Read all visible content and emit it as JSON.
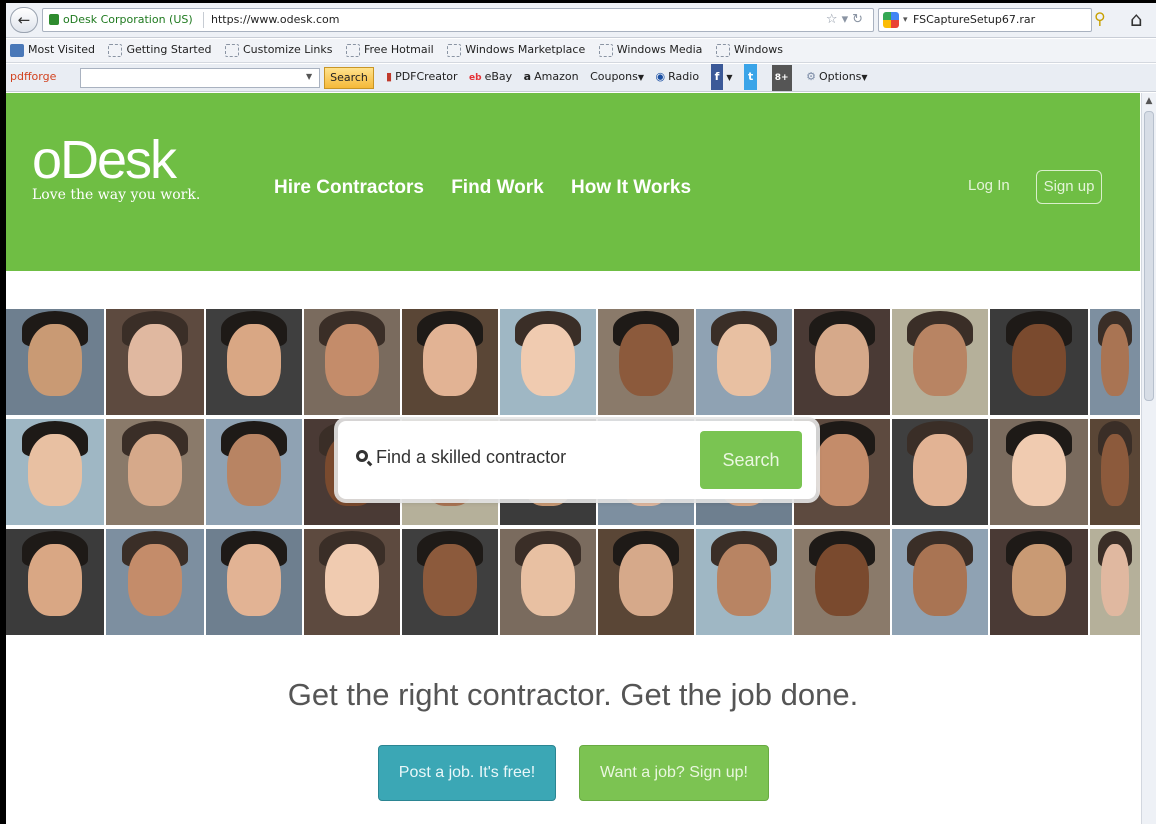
{
  "browser": {
    "site_identity": "oDesk Corporation (US)",
    "url": "https://www.odesk.com",
    "search_value": "FSCaptureSetup67.rar"
  },
  "bookmarks": [
    "Most Visited",
    "Getting Started",
    "Customize Links",
    "Free Hotmail",
    "Windows Marketplace",
    "Windows Media",
    "Windows"
  ],
  "toolbar": {
    "brand": "pdfforge",
    "search_label": "Search",
    "items": [
      "PDFCreator",
      "eBay",
      "Amazon",
      "Coupons",
      "Radio",
      "Options"
    ]
  },
  "header": {
    "logo": "oDesk",
    "tagline": "Love the way you work.",
    "nav": [
      "Hire Contractors",
      "Find Work",
      "How It Works"
    ],
    "login_label": "Log In",
    "signup_label": "Sign up"
  },
  "search": {
    "placeholder": "Find a skilled contractor",
    "button_label": "Search"
  },
  "headline": "Get the right contractor. Get the job done.",
  "cta": {
    "post_label": "Post a job. It's free!",
    "job_label": "Want a job? Sign up!"
  },
  "colors": {
    "brand_green": "#6fbe44",
    "button_teal": "#3ba7b5",
    "button_green": "#7cc352"
  }
}
